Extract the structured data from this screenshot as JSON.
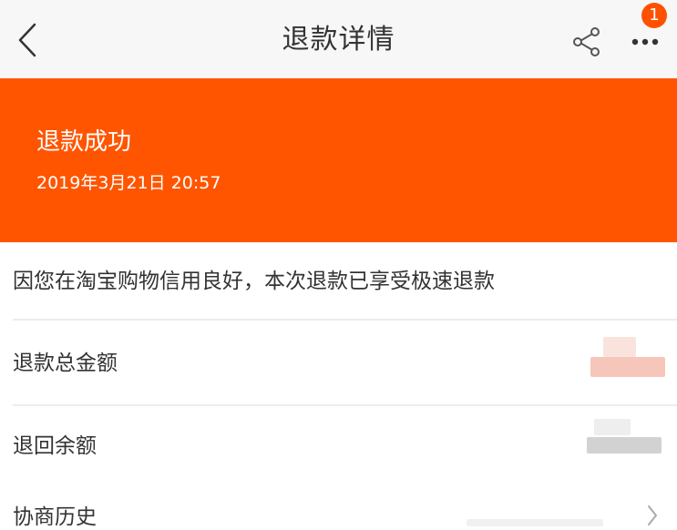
{
  "nav": {
    "back_icon": "chevron-left-icon",
    "title": "退款详情",
    "share_icon": "share-icon",
    "more_icon": "more-dots-icon",
    "badge_count": "1"
  },
  "status": {
    "title": "退款成功",
    "time": "2019年3月21日 20:57"
  },
  "notice": {
    "text": "因您在淘宝购物信用良好，本次退款已享受极速退款"
  },
  "rows": [
    {
      "label": "退款总金额",
      "value": ""
    },
    {
      "label": "退回余额",
      "value": ""
    },
    {
      "label": "协商历史",
      "chevron_icon": "chevron-right-icon"
    }
  ],
  "colors": {
    "brand_orange": "#ff5500",
    "badge": "#ff5000",
    "nav_background": "#f7f7f7",
    "text_primary": "#333333"
  }
}
